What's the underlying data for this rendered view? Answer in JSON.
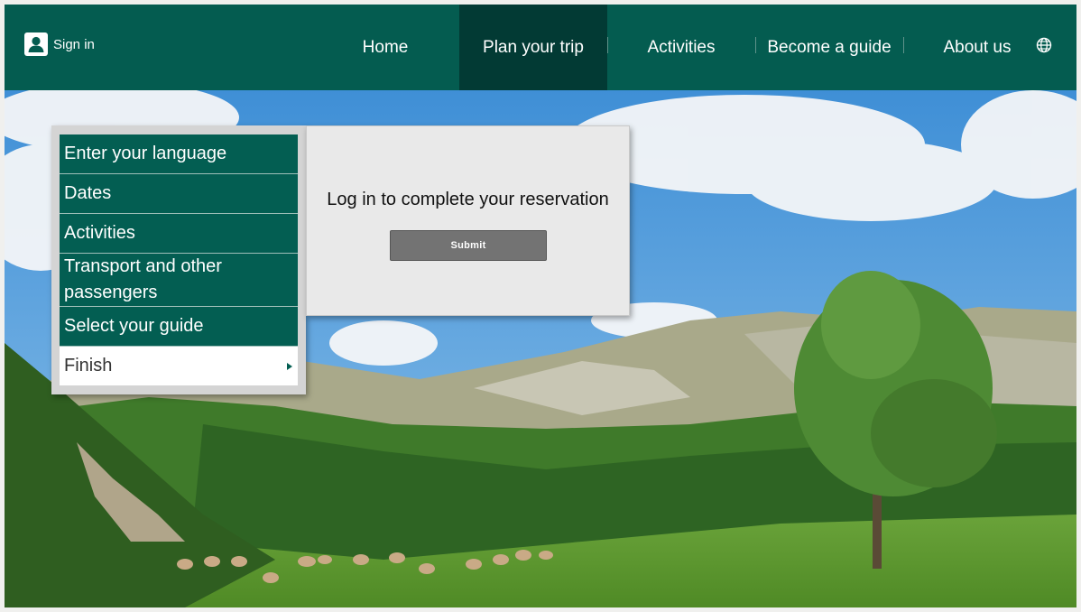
{
  "header": {
    "signin_label": "Sign in",
    "nav": [
      {
        "label": "Home",
        "active": false
      },
      {
        "label": "Plan your trip",
        "active": true
      },
      {
        "label": "Activities",
        "active": false
      },
      {
        "label": "Become a guide",
        "active": false
      },
      {
        "label": "About us",
        "active": false
      }
    ],
    "language_icon": "globe-icon",
    "user_icon": "user-icon"
  },
  "wizard": {
    "steps": [
      {
        "label": "Enter your language"
      },
      {
        "label": "Dates"
      },
      {
        "label": "Activities"
      },
      {
        "label": "Transport and other passengers"
      },
      {
        "label": "Select your guide"
      },
      {
        "label": "Finish",
        "current": true
      }
    ]
  },
  "login_card": {
    "message": "Log in to complete your reservation",
    "submit_label": "Submit"
  },
  "colors": {
    "header_bg": "#045c50",
    "nav_active_bg": "#023a34",
    "step_bg": "#035e52",
    "card_bg": "#e9e9e9",
    "button_bg": "#737373"
  }
}
